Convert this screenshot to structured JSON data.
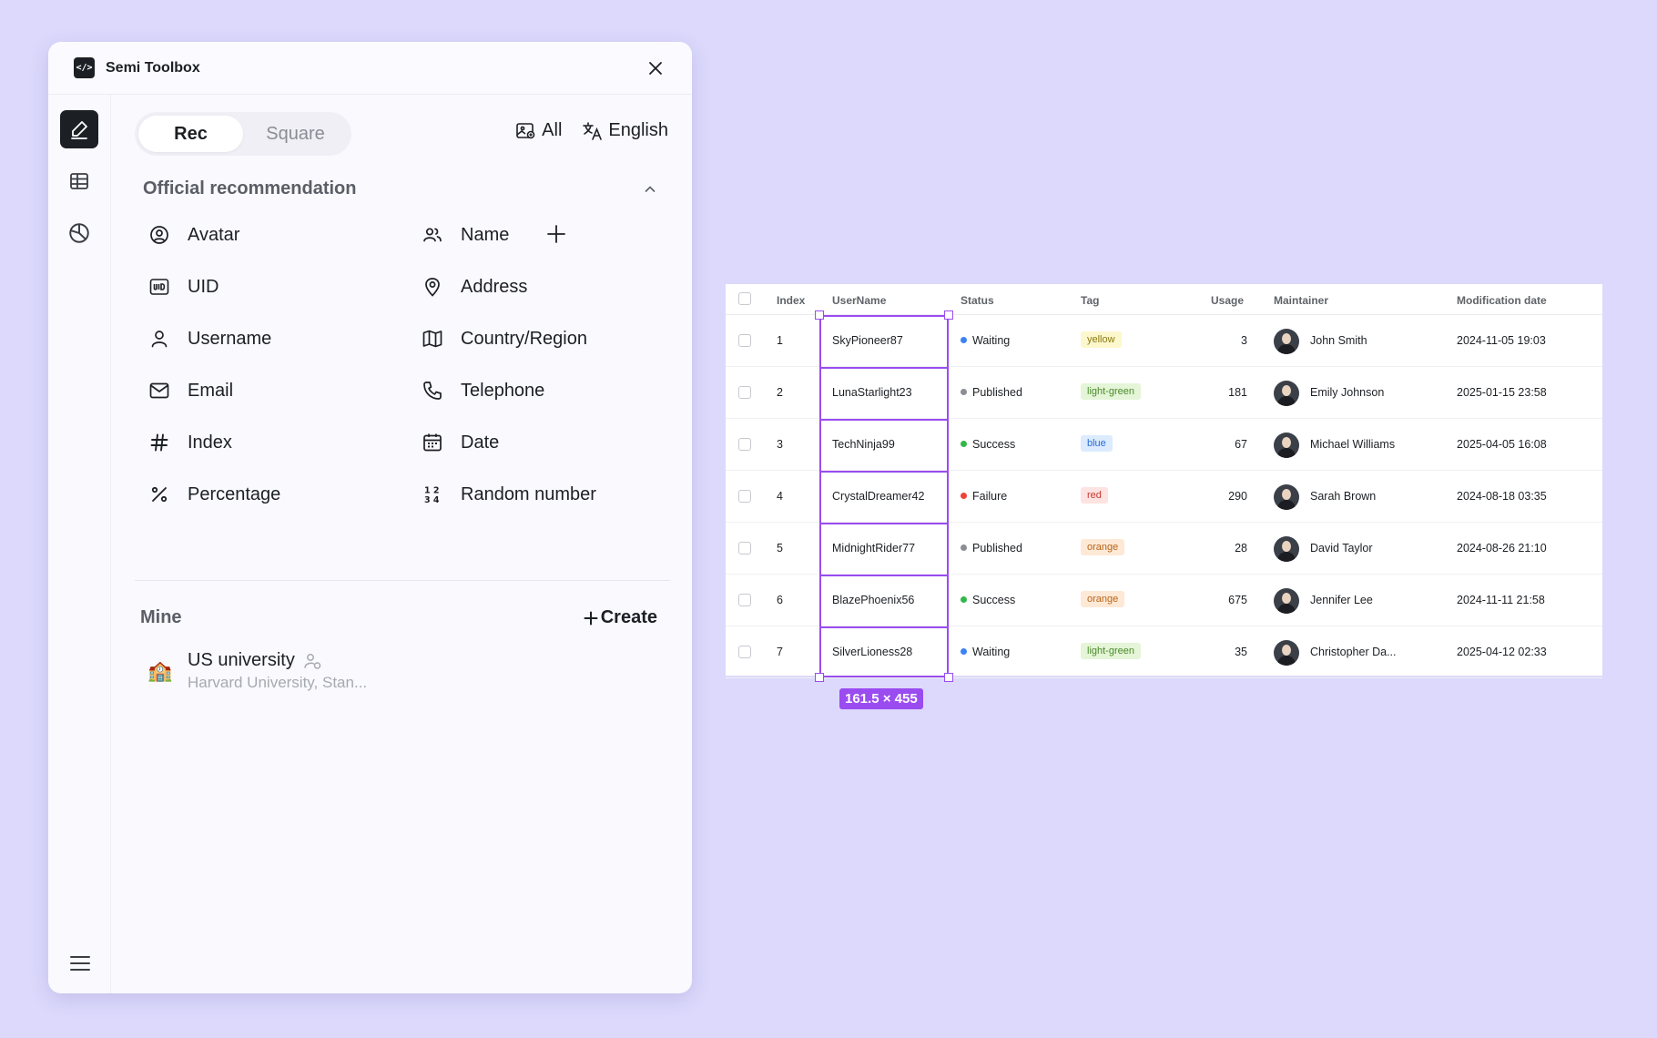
{
  "app": {
    "title": "Semi Toolbox",
    "logo_text": "</>"
  },
  "nav": {
    "items": [
      "pen-icon",
      "table-icon",
      "chart-pie-icon"
    ],
    "menu": "hamburger-icon"
  },
  "tabs": [
    {
      "label": "Rec",
      "active": true
    },
    {
      "label": "Square",
      "active": false
    }
  ],
  "actions": {
    "all": "All",
    "language": "English"
  },
  "recommendation": {
    "title": "Official recommendation",
    "fields": [
      {
        "label": "Avatar",
        "icon": "user-circle-icon"
      },
      {
        "label": "Name",
        "icon": "users-icon"
      },
      {
        "label": "UID",
        "icon": "uid-icon"
      },
      {
        "label": "Address",
        "icon": "location-pin-icon"
      },
      {
        "label": "Username",
        "icon": "user-icon"
      },
      {
        "label": "Country/Region",
        "icon": "map-icon"
      },
      {
        "label": "Email",
        "icon": "mail-icon"
      },
      {
        "label": "Telephone",
        "icon": "phone-icon"
      },
      {
        "label": "Index",
        "icon": "hash-icon"
      },
      {
        "label": "Date",
        "icon": "calendar-icon"
      },
      {
        "label": "Percentage",
        "icon": "percent-icon"
      },
      {
        "label": "Random number",
        "icon": "random-number-icon"
      }
    ]
  },
  "mine": {
    "title": "Mine",
    "create": "Create",
    "items": [
      {
        "name": "US university",
        "desc": "Harvard University, Stan...",
        "emoji": "🏫"
      }
    ]
  },
  "table": {
    "columns": [
      "Index",
      "UserName",
      "Status",
      "Tag",
      "Usage",
      "Maintainer",
      "Modification date"
    ],
    "rows": [
      {
        "index": "1",
        "username": "SkyPioneer87",
        "status": "Waiting",
        "status_color": "#3b82f6",
        "tag": "yellow",
        "tag_bg": "#fdf7cd",
        "tag_fg": "#8a7a10",
        "usage": "3",
        "maintainer": "John Smith",
        "date": "2024-11-05 19:03"
      },
      {
        "index": "2",
        "username": "LunaStarlight23",
        "status": "Published",
        "status_color": "#8b8d95",
        "tag": "light-green",
        "tag_bg": "#e4f5d8",
        "tag_fg": "#4d8a2b",
        "usage": "181",
        "maintainer": "Emily Johnson",
        "date": "2025-01-15 23:58"
      },
      {
        "index": "3",
        "username": "TechNinja99",
        "status": "Success",
        "status_color": "#32b84a",
        "tag": "blue",
        "tag_bg": "#dcebfd",
        "tag_fg": "#2b6ad8",
        "usage": "67",
        "maintainer": "Michael Williams",
        "date": "2025-04-05 16:08"
      },
      {
        "index": "4",
        "username": "CrystalDreamer42",
        "status": "Failure",
        "status_color": "#f0413a",
        "tag": "red",
        "tag_bg": "#fde3e1",
        "tag_fg": "#c43a32",
        "usage": "290",
        "maintainer": "Sarah Brown",
        "date": "2024-08-18 03:35"
      },
      {
        "index": "5",
        "username": "MidnightRider77",
        "status": "Published",
        "status_color": "#8b8d95",
        "tag": "orange",
        "tag_bg": "#fde9d6",
        "tag_fg": "#b8641a",
        "usage": "28",
        "maintainer": "David Taylor",
        "date": "2024-08-26 21:10"
      },
      {
        "index": "6",
        "username": "BlazePhoenix56",
        "status": "Success",
        "status_color": "#32b84a",
        "tag": "orange",
        "tag_bg": "#fde9d6",
        "tag_fg": "#b8641a",
        "usage": "675",
        "maintainer": "Jennifer Lee",
        "date": "2024-11-11 21:58"
      },
      {
        "index": "7",
        "username": "SilverLioness28",
        "status": "Waiting",
        "status_color": "#3b82f6",
        "tag": "light-green",
        "tag_bg": "#e4f5d8",
        "tag_fg": "#4d8a2b",
        "usage": "35",
        "maintainer": "Christopher Da...",
        "date": "2025-04-12 02:33"
      }
    ]
  },
  "selection": {
    "label": "161.5 × 455",
    "color": "#9a4cf0"
  }
}
